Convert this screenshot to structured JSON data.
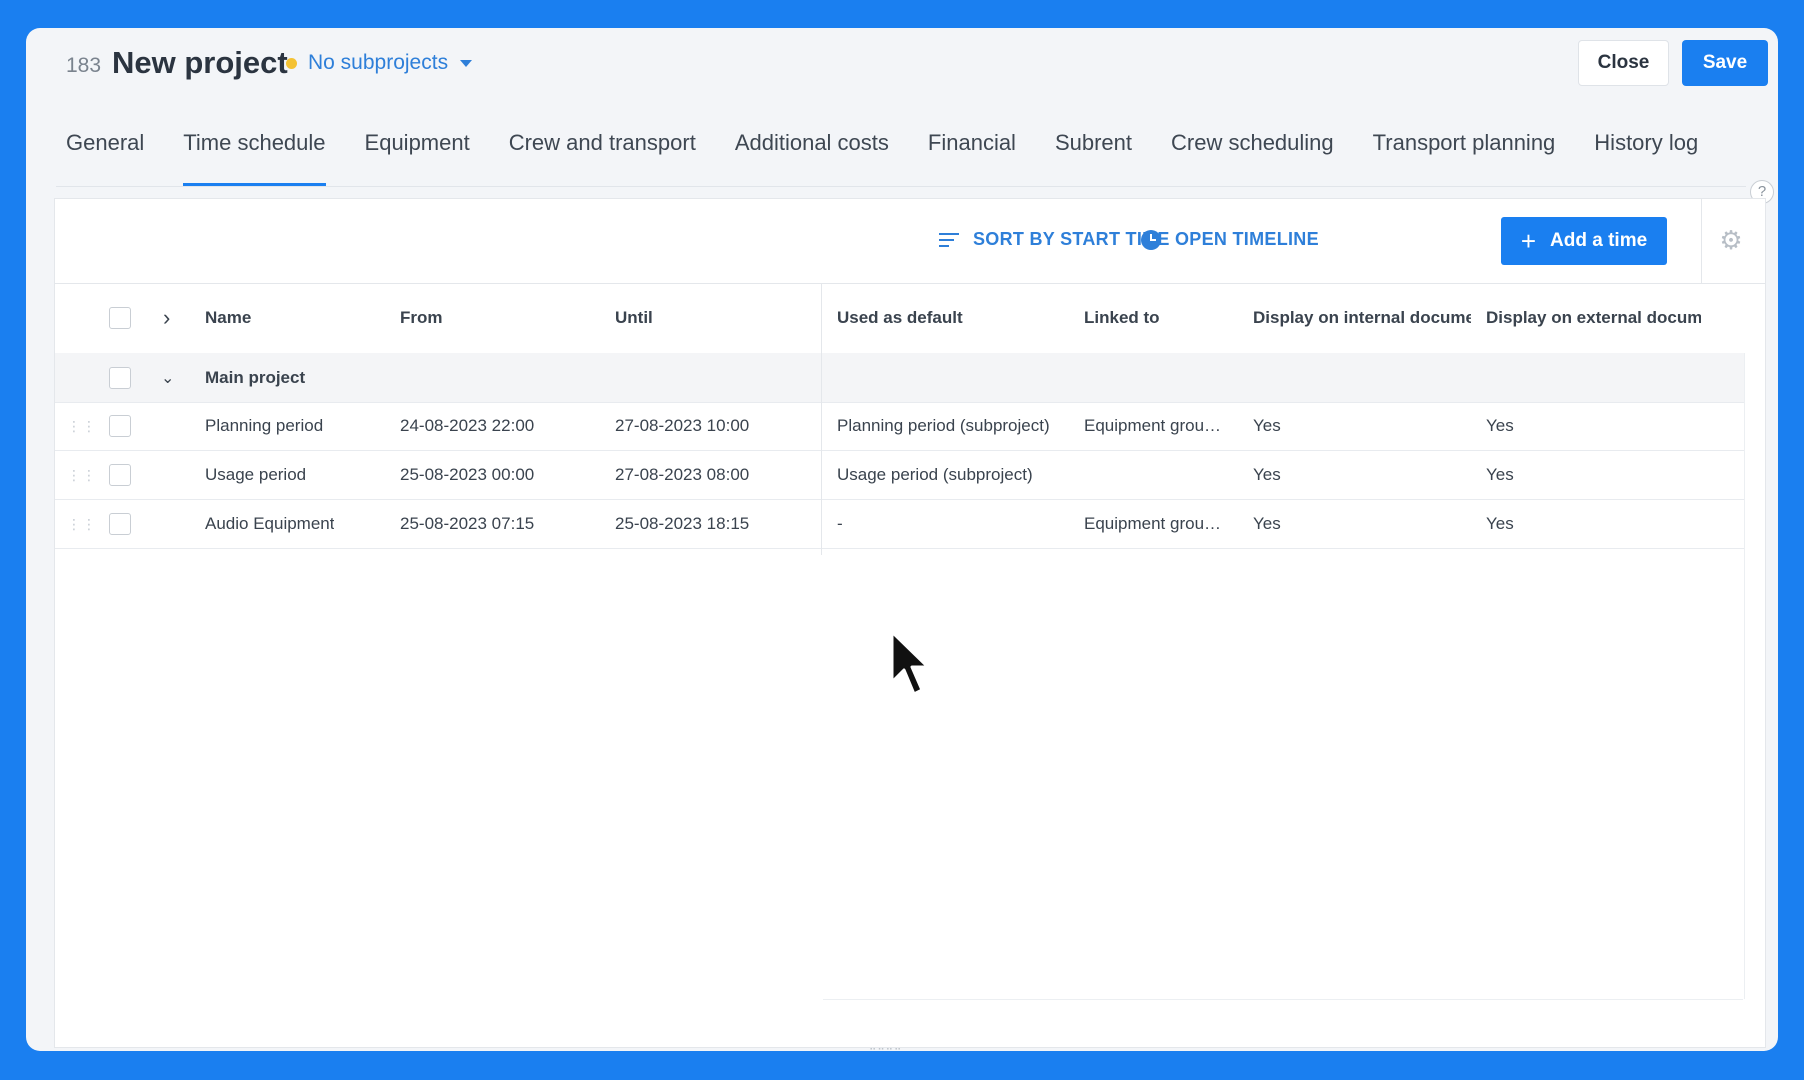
{
  "header": {
    "project_number": "183",
    "project_title": "New project",
    "subprojects_label": "No subprojects",
    "close_label": "Close",
    "save_label": "Save",
    "status_color": "#f4c234"
  },
  "tabs": [
    {
      "label": "General"
    },
    {
      "label": "Time schedule",
      "active": true
    },
    {
      "label": "Equipment"
    },
    {
      "label": "Crew and transport"
    },
    {
      "label": "Additional costs"
    },
    {
      "label": "Financial"
    },
    {
      "label": "Subrent"
    },
    {
      "label": "Crew scheduling"
    },
    {
      "label": "Transport planning"
    },
    {
      "label": "History log"
    }
  ],
  "toolbar": {
    "sort_label": "SORT BY START TIME",
    "timeline_label": "OPEN TIMELINE",
    "add_label": "Add a time"
  },
  "table": {
    "columns": {
      "name": "Name",
      "from": "From",
      "until": "Until",
      "default": "Used as default",
      "linked": "Linked to",
      "internal": "Display on internal documer",
      "external": "Display on external docume"
    },
    "group": {
      "name": "Main project"
    },
    "rows": [
      {
        "name": "Planning period",
        "from": "24-08-2023 22:00",
        "until": "27-08-2023 10:00",
        "default": "Planning period (subproject)",
        "linked": "Equipment grou…",
        "internal": "Yes",
        "external": "Yes"
      },
      {
        "name": "Usage period",
        "from": "25-08-2023 00:00",
        "until": "27-08-2023 08:00",
        "default": "Usage period (subproject)",
        "linked": "",
        "internal": "Yes",
        "external": "Yes"
      },
      {
        "name": "Audio Equipment",
        "from": "25-08-2023 07:15",
        "until": "25-08-2023 18:15",
        "default": "-",
        "linked": "Equipment grou…",
        "internal": "Yes",
        "external": "Yes"
      }
    ]
  },
  "colors": {
    "accent": "#1a7ff0",
    "link": "#2e7fd9",
    "background": "#1a7ff0"
  }
}
